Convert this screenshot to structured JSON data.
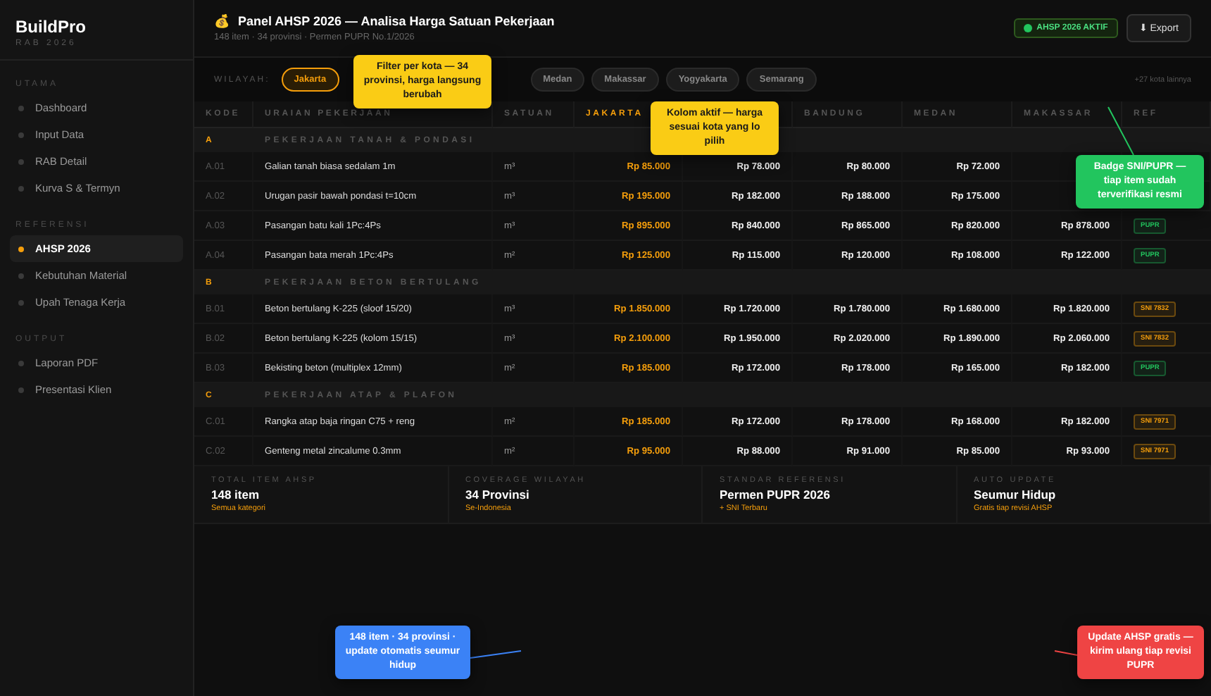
{
  "sidebar": {
    "brand": "BuildPro",
    "subtitle": "RAB 2026",
    "sections": [
      {
        "title": "UTAMA",
        "items": [
          {
            "label": "Dashboard",
            "selected": false
          },
          {
            "label": "Input Data",
            "selected": false
          },
          {
            "label": "RAB Detail",
            "selected": false
          },
          {
            "label": "Kurva S & Termyn",
            "selected": false
          }
        ]
      },
      {
        "title": "REFERENSI",
        "items": [
          {
            "label": "AHSP 2026",
            "selected": true
          },
          {
            "label": "Kebutuhan Material",
            "selected": false
          },
          {
            "label": "Upah Tenaga Kerja",
            "selected": false
          }
        ]
      },
      {
        "title": "OUTPUT",
        "items": [
          {
            "label": "Laporan PDF",
            "selected": false
          },
          {
            "label": "Presentasi Klien",
            "selected": false
          }
        ]
      }
    ]
  },
  "header": {
    "icon": "💰",
    "title": "Panel AHSP 2026 — Analisa Harga Satuan Pekerjaan",
    "subtitle": "148 item · 34 provinsi · Permen PUPR No.1/2026",
    "status_badge": "AHSP 2026 AKTIF",
    "export_button": "⬇ Export"
  },
  "filter": {
    "label": "WILAYAH:",
    "chips": [
      {
        "label": "Jakarta",
        "selected": true
      },
      {
        "label": "Medan",
        "selected": false
      },
      {
        "label": "Makassar",
        "selected": false
      },
      {
        "label": "Yogyakarta",
        "selected": false
      },
      {
        "label": "Semarang",
        "selected": false
      }
    ],
    "more": "+27 kota lainnya"
  },
  "table": {
    "columns": [
      "KODE",
      "URAIAN PEKERJAAN",
      "SATUAN",
      "JAKARTA",
      "BANDUNG",
      "MEDAN",
      "MAKASSAR",
      "REF"
    ],
    "rows": [
      {
        "kind": "section",
        "code": "A",
        "title": "PEKERJAAN TANAH & PONDASI"
      },
      {
        "kind": "item",
        "code": "A.01",
        "desc": "Galian tanah biasa sedalam 1m",
        "unit": "m³",
        "prices": [
          "Rp 85.000",
          "Rp 78.000",
          "Rp 80.000",
          "Rp 72.000"
        ]
      },
      {
        "kind": "item",
        "code": "A.02",
        "desc": "Urugan pasir bawah pondasi t=10cm",
        "unit": "m³",
        "prices": [
          "Rp 195.000",
          "Rp 182.000",
          "Rp 188.000",
          "Rp 175.000"
        ]
      },
      {
        "kind": "item",
        "code": "A.03",
        "desc": "Pasangan batu kali 1Pc:4Ps",
        "unit": "m³",
        "prices": [
          "Rp 895.000",
          "Rp 840.000",
          "Rp 865.000",
          "Rp 820.000",
          "Rp 878.000"
        ],
        "ref": {
          "label": "PUPR",
          "color": "#22c55e"
        }
      },
      {
        "kind": "item",
        "code": "A.04",
        "desc": "Pasangan bata merah 1Pc:4Ps",
        "unit": "m²",
        "prices": [
          "Rp 125.000",
          "Rp 115.000",
          "Rp 120.000",
          "Rp 108.000",
          "Rp 122.000"
        ],
        "ref": {
          "label": "PUPR",
          "color": "#22c55e"
        }
      },
      {
        "kind": "section",
        "code": "B",
        "title": "PEKERJAAN BETON BERTULANG"
      },
      {
        "kind": "item",
        "code": "B.01",
        "desc": "Beton bertulang K-225 (sloof 15/20)",
        "unit": "m³",
        "prices": [
          "Rp 1.850.000",
          "Rp 1.720.000",
          "Rp 1.780.000",
          "Rp 1.680.000",
          "Rp 1.820.000"
        ],
        "ref": {
          "label": "SNI 7832",
          "color": "#f59e0b"
        }
      },
      {
        "kind": "item",
        "code": "B.02",
        "desc": "Beton bertulang K-225 (kolom 15/15)",
        "unit": "m³",
        "prices": [
          "Rp 2.100.000",
          "Rp 1.950.000",
          "Rp 2.020.000",
          "Rp 1.890.000",
          "Rp 2.060.000"
        ],
        "ref": {
          "label": "SNI 7832",
          "color": "#f59e0b"
        }
      },
      {
        "kind": "item",
        "code": "B.03",
        "desc": "Bekisting beton (multiplex 12mm)",
        "unit": "m²",
        "prices": [
          "Rp 185.000",
          "Rp 172.000",
          "Rp 178.000",
          "Rp 165.000",
          "Rp 182.000"
        ],
        "ref": {
          "label": "PUPR",
          "color": "#22c55e"
        }
      },
      {
        "kind": "section",
        "code": "C",
        "title": "PEKERJAAN ATAP & PLAFON"
      },
      {
        "kind": "item",
        "code": "C.01",
        "desc": "Rangka atap baja ringan C75 + reng",
        "unit": "m²",
        "prices": [
          "Rp 185.000",
          "Rp 172.000",
          "Rp 178.000",
          "Rp 168.000",
          "Rp 182.000"
        ],
        "ref": {
          "label": "SNI 7971",
          "color": "#f59e0b"
        }
      },
      {
        "kind": "item",
        "code": "C.02",
        "desc": "Genteng metal zincalume 0.3mm",
        "unit": "m²",
        "prices": [
          "Rp 95.000",
          "Rp 88.000",
          "Rp 91.000",
          "Rp 85.000",
          "Rp 93.000"
        ],
        "ref": {
          "label": "SNI 7971",
          "color": "#f59e0b"
        }
      }
    ]
  },
  "summary": [
    {
      "label": "TOTAL ITEM AHSP",
      "value": "148 item",
      "note": "Semua kategori"
    },
    {
      "label": "COVERAGE WILAYAH",
      "value": "34 Provinsi",
      "note": "Se-Indonesia"
    },
    {
      "label": "STANDAR REFERENSI",
      "value": "Permen PUPR 2026",
      "note": "+ SNI Terbaru"
    },
    {
      "label": "AUTO UPDATE",
      "value": "Seumur Hidup",
      "note": "Gratis tiap revisi AHSP"
    }
  ],
  "callouts": [
    {
      "text": "Filter per kota — 34 provinsi, harga langsung berubah",
      "color": "#facc15"
    },
    {
      "text": "Kolom aktif — harga sesuai kota yang lo pilih",
      "color": "#facc15"
    },
    {
      "text": "Badge SNI/PUPR — tiap item sudah terverifikasi resmi",
      "color": "#22c55e"
    },
    {
      "text": "148 item · 34 provinsi · update otomatis seumur hidup",
      "color": "#3b82f6"
    },
    {
      "text": "Update AHSP gratis — kirim ulang tiap revisi PUPR",
      "color": "#ef4444"
    }
  ]
}
